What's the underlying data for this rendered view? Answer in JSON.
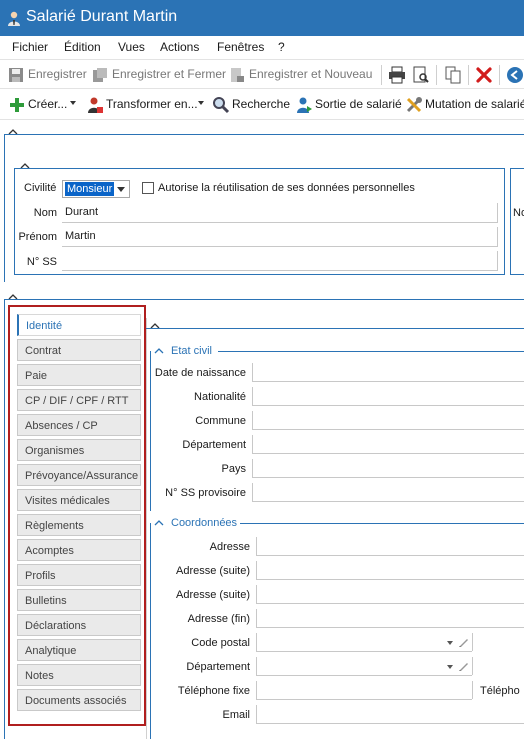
{
  "window": {
    "title": "Salarié Durant Martin"
  },
  "menu": [
    "Fichier",
    "Édition",
    "Vues",
    "Actions",
    "Fenêtres",
    "?"
  ],
  "toolbar1": {
    "save": "Enregistrer",
    "save_close": "Enregistrer et Fermer",
    "save_new": "Enregistrer et Nouveau"
  },
  "toolbar2": {
    "create": "Créer...",
    "transform": "Transformer en...",
    "search": "Recherche",
    "exit": "Sortie de salarié",
    "mutation": "Mutation de salarié"
  },
  "header_form": {
    "civilite_label": "Civilité",
    "civilite_value": "Monsieur",
    "consent_label": "Autorise la réutilisation de ses données personnelles",
    "nom_label": "Nom",
    "nom_value": "Durant",
    "prenom_label": "Prénom",
    "prenom_value": "Martin",
    "nss_label": "N° SS",
    "nss_value": "",
    "right_truncated_label": "No"
  },
  "tabs": [
    "Identité",
    "Contrat",
    "Paie",
    "CP / DIF / CPF / RTT",
    "Absences / CP",
    "Organismes",
    "Prévoyance/Assurance",
    "Visites médicales",
    "Règlements",
    "Acomptes",
    "Profils",
    "Bulletins",
    "Déclarations",
    "Analytique",
    "Notes",
    "Documents associés"
  ],
  "etat_civil": {
    "title": "Etat civil",
    "fields": [
      "Date de naissance",
      "Nationalité",
      "Commune",
      "Département",
      "Pays",
      "N° SS provisoire"
    ]
  },
  "coordonnees": {
    "title": "Coordonnées",
    "fields": [
      "Adresse",
      "Adresse (suite)",
      "Adresse (suite)",
      "Adresse (fin)",
      "Code postal",
      "Département",
      "Téléphone fixe",
      "Email"
    ],
    "right_label": "Télépho"
  },
  "colors": {
    "titlebar": "#2b73b5",
    "accent": "#2b73b5",
    "highlight_border": "#b01f1f"
  }
}
